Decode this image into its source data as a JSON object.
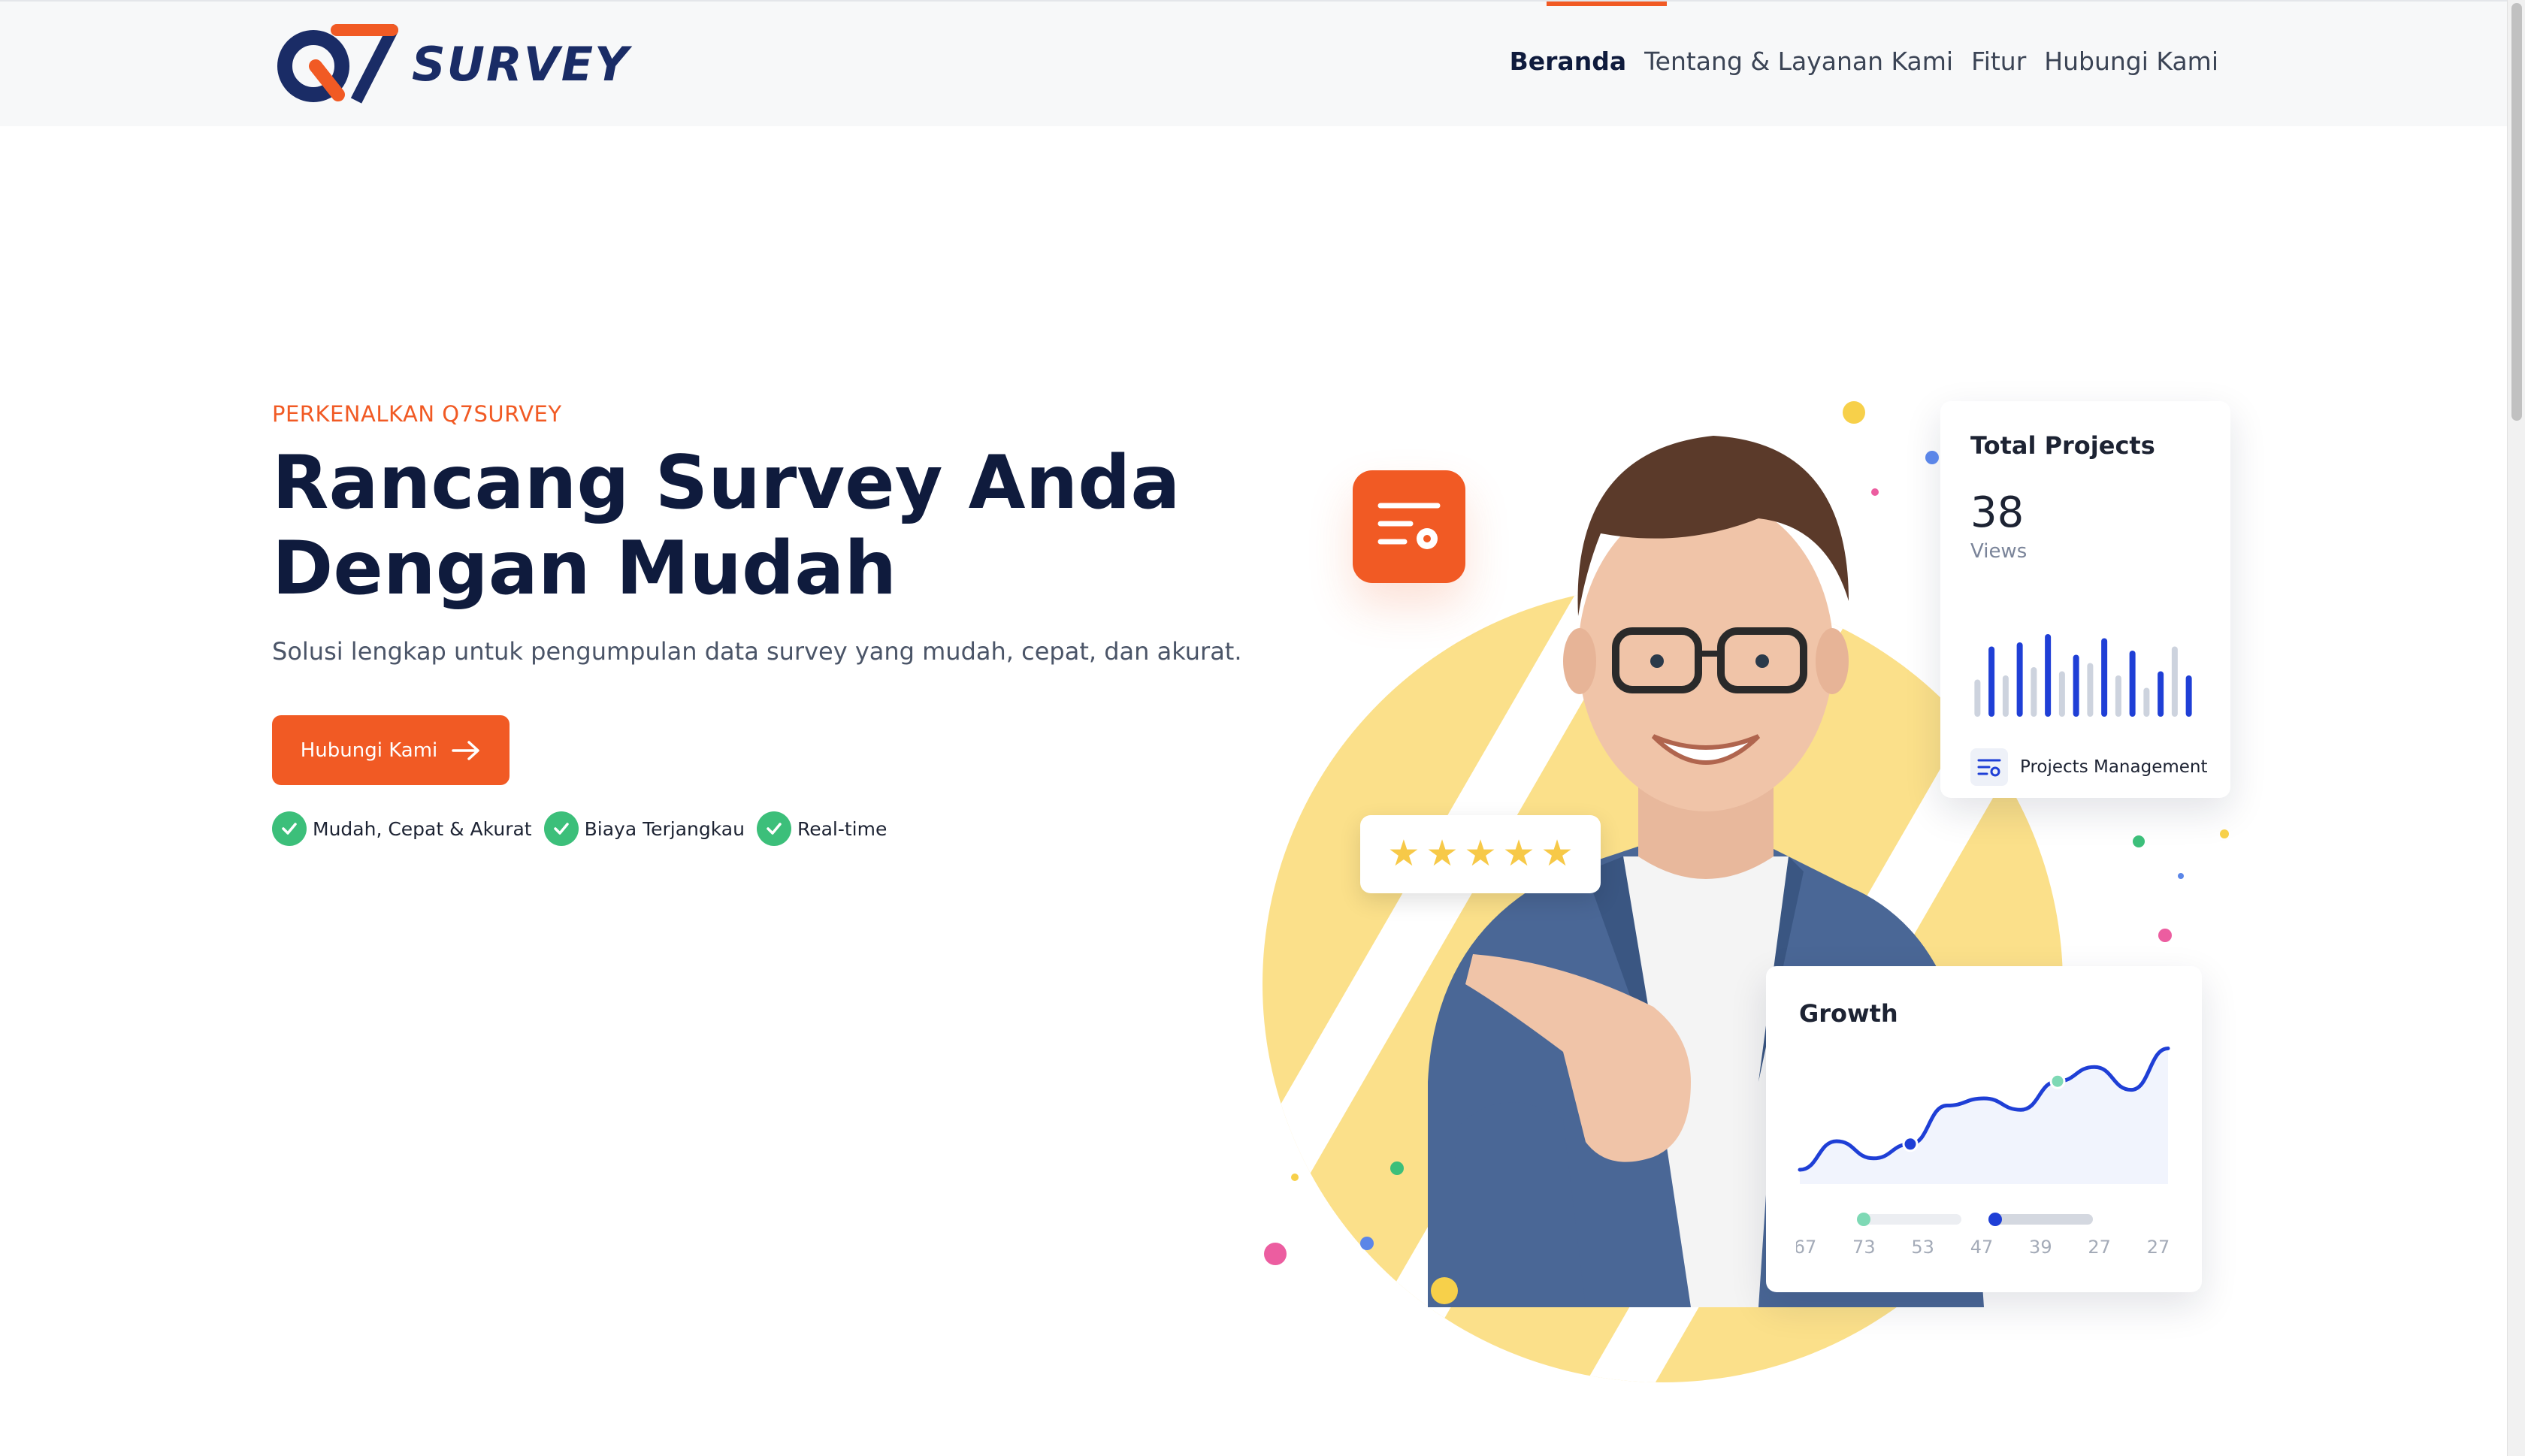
{
  "nav": {
    "logo_text": "SURVEY",
    "items": [
      {
        "label": "Beranda",
        "active": true
      },
      {
        "label": "Tentang & Layanan Kami",
        "active": false
      },
      {
        "label": "Fitur",
        "active": false
      },
      {
        "label": "Hubungi Kami",
        "active": false
      }
    ]
  },
  "hero": {
    "eyebrow": "PERKENALKAN Q7SURVEY",
    "headline_line1": "Rancang Survey Anda",
    "headline_line2": "Dengan Mudah",
    "subtitle": "Solusi lengkap untuk pengumpulan data survey yang mudah, cepat, dan akurat.",
    "cta_label": "Hubungi Kami",
    "features": [
      "Mudah, Cepat & Akurat",
      "Biaya Terjangkau",
      "Real-time"
    ]
  },
  "projects_card": {
    "title": "Total Projects",
    "value": "38",
    "unit": "Views",
    "footer_label": "Projects Management",
    "bars": [
      0.45,
      0.85,
      0.5,
      0.9,
      0.6,
      1.0,
      0.55,
      0.75,
      0.65,
      0.95,
      0.5,
      0.8,
      0.35,
      0.55,
      0.85,
      0.5
    ]
  },
  "growth_card": {
    "title": "Growth",
    "x_labels": [
      "67",
      "73",
      "53",
      "47",
      "39",
      "27",
      "27"
    ],
    "line": [
      0.1,
      0.3,
      0.18,
      0.28,
      0.55,
      0.6,
      0.52,
      0.72,
      0.82,
      0.66,
      0.95
    ]
  },
  "rating_stars": 5,
  "colors": {
    "accent": "#f15a24",
    "navy": "#0f1b3d",
    "check_green": "#3cbf7a",
    "chart_blue": "#1f3fd6",
    "blob_yellow": "#fbe08a"
  }
}
